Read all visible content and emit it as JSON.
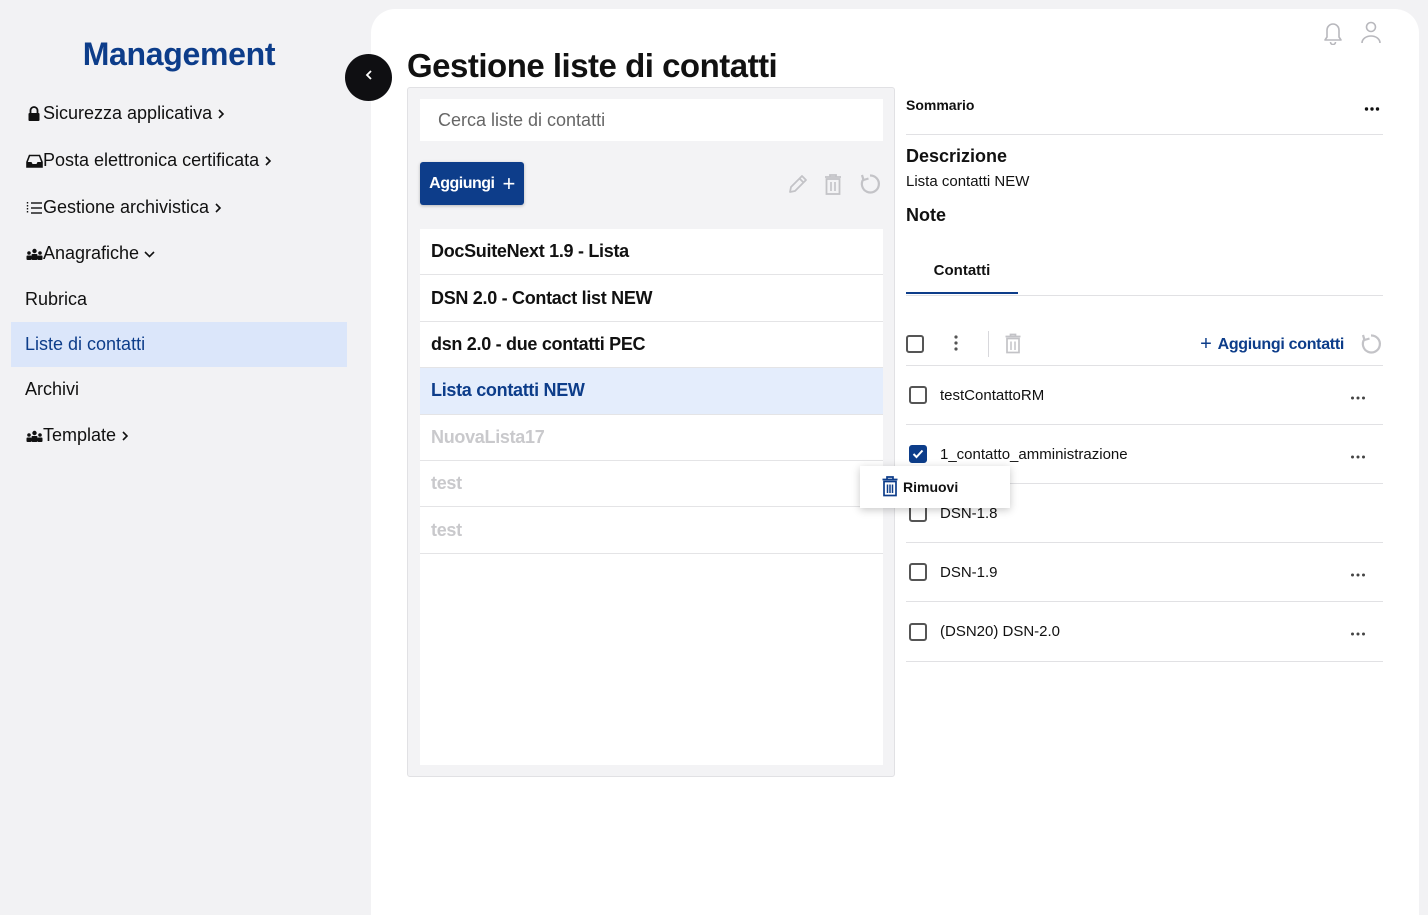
{
  "app": {
    "brand": "Management"
  },
  "sidebar": {
    "items": [
      {
        "label": "Sicurezza applicativa",
        "icon": "lock-icon",
        "suffix": "chevron-right-icon"
      },
      {
        "label": "Posta elettronica certificata",
        "icon": "inbox-icon",
        "suffix": "chevron-right-icon"
      },
      {
        "label": "Gestione archivistica",
        "icon": "list-icon",
        "suffix": "chevron-right-icon"
      },
      {
        "label": "Anagrafiche",
        "icon": "users-icon",
        "suffix": "chevron-down-icon"
      },
      {
        "label": "Rubrica"
      },
      {
        "label": "Liste di contatti",
        "active": true
      },
      {
        "label": "Archivi"
      },
      {
        "label": "Template",
        "icon": "users-icon",
        "suffix": "chevron-right-icon"
      }
    ]
  },
  "page": {
    "title": "Gestione liste di contatti"
  },
  "list_panel": {
    "search_placeholder": "Cerca liste di contatti",
    "add_label": "Aggiungi",
    "rows": [
      {
        "label": "DocSuiteNext 1.9 - Lista",
        "state": "normal"
      },
      {
        "label": "DSN 2.0 - Contact list NEW",
        "state": "normal"
      },
      {
        "label": "dsn 2.0 - due contatti PEC",
        "state": "normal"
      },
      {
        "label": "Lista contatti NEW",
        "state": "selected"
      },
      {
        "label": "NuovaLista17",
        "state": "disabled"
      },
      {
        "label": "test",
        "state": "disabled"
      },
      {
        "label": "test",
        "state": "disabled"
      }
    ]
  },
  "detail": {
    "summary_label": "Sommario",
    "description_label": "Descrizione",
    "description_value": "Lista contatti NEW",
    "note_label": "Note",
    "tab_label": "Contatti",
    "add_contacts_label": "Aggiungi contatti",
    "contacts": [
      {
        "name": "testContattoRM",
        "checked": false
      },
      {
        "name": "1_contatto_amministrazione",
        "checked": true
      },
      {
        "name": "DSN-1.8",
        "checked": false
      },
      {
        "name": "DSN-1.9",
        "checked": false
      },
      {
        "name": "(DSN20) DSN-2.0",
        "checked": false
      }
    ],
    "context_menu": {
      "remove_label": "Rimuovi"
    }
  },
  "colors": {
    "accent": "#0d3d8a",
    "selected_bg": "#e4edfc",
    "sidebar_active_bg": "#dbe6fa"
  }
}
